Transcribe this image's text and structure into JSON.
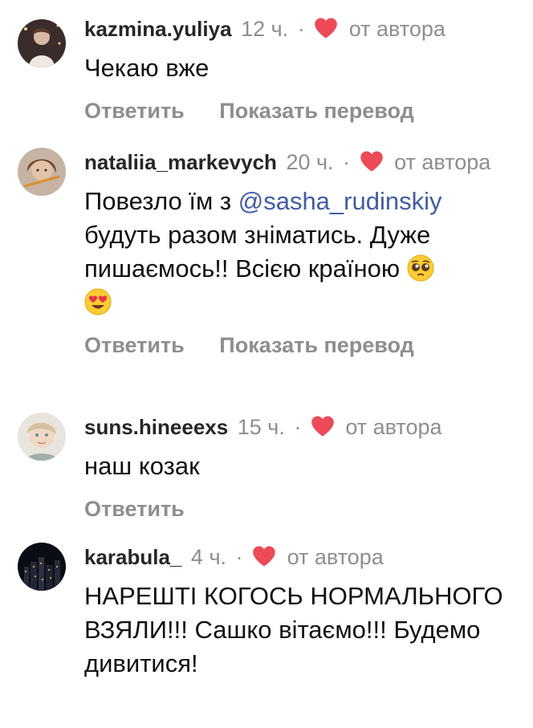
{
  "comments": [
    {
      "username": "kazmina.yuliya",
      "time": "12 ч.",
      "separator": "·",
      "by_author": "от автора",
      "text": "Чекаю вже",
      "reply": "Ответить",
      "translate": "Показать перевод"
    },
    {
      "username": "nataliia_markevych",
      "time": "20 ч.",
      "separator": "·",
      "by_author": "от автора",
      "text_before": "Повезло їм з ",
      "mention": "@sasha_rudinskiy",
      "text_after": " будуть разом зніматись. Дуже пишаємось!! Всією країною ",
      "reply": "Ответить",
      "translate": "Показать перевод"
    },
    {
      "username": "suns.hineeexs",
      "time": "15 ч.",
      "separator": "·",
      "by_author": "от автора",
      "text": "наш козак",
      "reply": "Ответить"
    },
    {
      "username": "karabula_",
      "time": "4 ч.",
      "separator": "·",
      "by_author": "от автора",
      "text": "НАРЕШТІ КОГОСЬ НОРМАЛЬНОГО ВЗЯЛИ!!! Сашко вітаємо!!! Будемо дивитися!"
    }
  ],
  "colors": {
    "heart": "#ed4956",
    "meta": "#8e8e8e",
    "mention": "#3f5da8"
  },
  "icons": {
    "heart": "heart-icon",
    "pleading": "pleading-face-emoji",
    "heart_eyes": "heart-eyes-emoji"
  }
}
